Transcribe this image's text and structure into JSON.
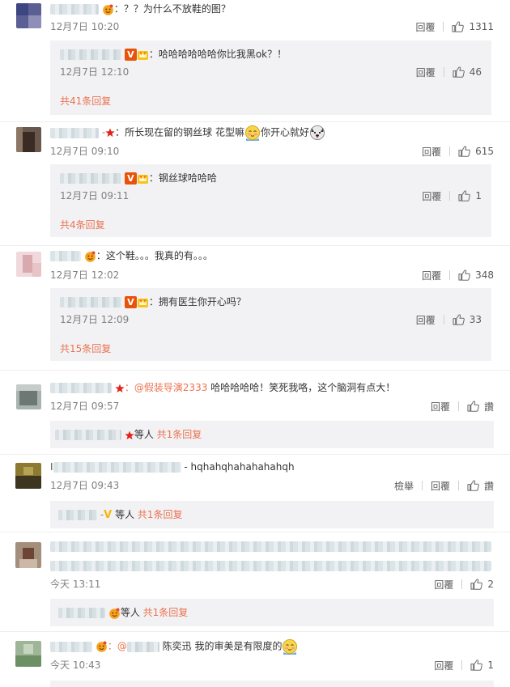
{
  "comments": [
    {
      "text": "：？？为什么不放鞋的图？",
      "time": "12月7日 10:20",
      "reply_label": "回覆",
      "likes": "1311",
      "sub": {
        "text": "：哈哈哈哈哈哈你比我黑ok？！",
        "time": "12月7日 12:10",
        "reply_label": "回覆",
        "likes": "46"
      },
      "more": "共41条回复"
    },
    {
      "text_a": "：所长现在留的钢丝球 花型嘛",
      "text_b": "你开心就好",
      "time": "12月7日 09:10",
      "reply_label": "回覆",
      "likes": "615",
      "sub": {
        "text": "：钢丝球哈哈哈",
        "time": "12月7日 09:11",
        "reply_label": "回覆",
        "likes": "1"
      },
      "more": "共4条回复"
    },
    {
      "text": "：这个鞋。。。我真的有。。。",
      "time": "12月7日 12:02",
      "reply_label": "回覆",
      "likes": "348",
      "sub": {
        "text": "：拥有医生你开心吗？",
        "time": "12月7日 12:09",
        "reply_label": "回覆",
        "likes": "33"
      },
      "more": "共15条回复"
    },
    {
      "mention": "：@假装导演2333",
      "text": " 哈哈哈哈哈！笑死我咯，这个脑洞有点大！",
      "time": "12月7日 09:57",
      "reply_label": "回覆",
      "likes": "讚",
      "more_a": "等人",
      "more_b": "共1条回复"
    },
    {
      "name_prefix": "I",
      "text": "- hqhahqhahahahahqh",
      "time": "12月7日 09:43",
      "report_label": "檢舉",
      "reply_label": "回覆",
      "likes": "讚",
      "more_a": "等人",
      "more_b": "共1条回复"
    },
    {
      "time": "今天 13:11",
      "reply_label": "回覆",
      "likes": "2",
      "more_a": "等人",
      "more_b": "共1条回复"
    },
    {
      "mention": "：@",
      "text": " 陈奕迅 我的审美是有限度的",
      "time": "今天 10:43",
      "reply_label": "回覆",
      "likes": "1"
    }
  ],
  "colors": {
    "link": "#eb7350",
    "reply_bg": "#f2f2f5",
    "meta": "#808080"
  },
  "icons": [
    "thumb-up-icon",
    "red-star-icon",
    "v-badge-icon",
    "crown-icon",
    "blush-emoji-icon",
    "dog-emoji-icon"
  ]
}
